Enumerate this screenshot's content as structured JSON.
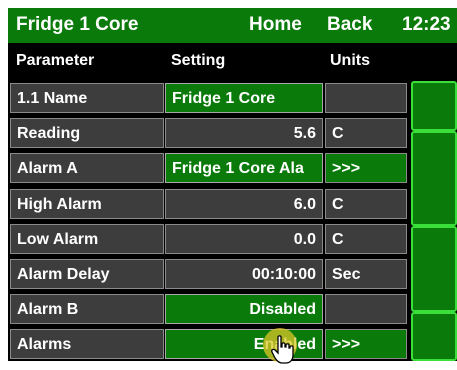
{
  "titlebar": {
    "title": "Fridge 1 Core",
    "home_label": "Home",
    "back_label": "Back",
    "time": "12:23"
  },
  "table": {
    "headers": {
      "parameter": "Parameter",
      "setting": "Setting",
      "units": "Units"
    },
    "rows": [
      {
        "parameter": "1.1 Name",
        "setting": "Fridge 1 Core",
        "units": ""
      },
      {
        "parameter": "Reading",
        "setting": "5.6",
        "units": "C"
      },
      {
        "parameter": "Alarm A",
        "setting": "Fridge 1 Core Ala",
        "units": ">>>"
      },
      {
        "parameter": "High Alarm",
        "setting": "6.0",
        "units": "C"
      },
      {
        "parameter": "Low Alarm",
        "setting": "0.0",
        "units": "C"
      },
      {
        "parameter": "Alarm Delay",
        "setting": "00:10:00",
        "units": "Sec"
      },
      {
        "parameter": "Alarm B",
        "setting": "Disabled",
        "units": ""
      },
      {
        "parameter": "Alarms",
        "setting": "Enabled",
        "units": ">>>"
      }
    ]
  },
  "colors": {
    "accent": "#0a7a0a",
    "cell_bg": "#3d3d3d",
    "highlight": "#3adf3a"
  },
  "icons": {
    "cursor": "hand-pointer-icon"
  }
}
